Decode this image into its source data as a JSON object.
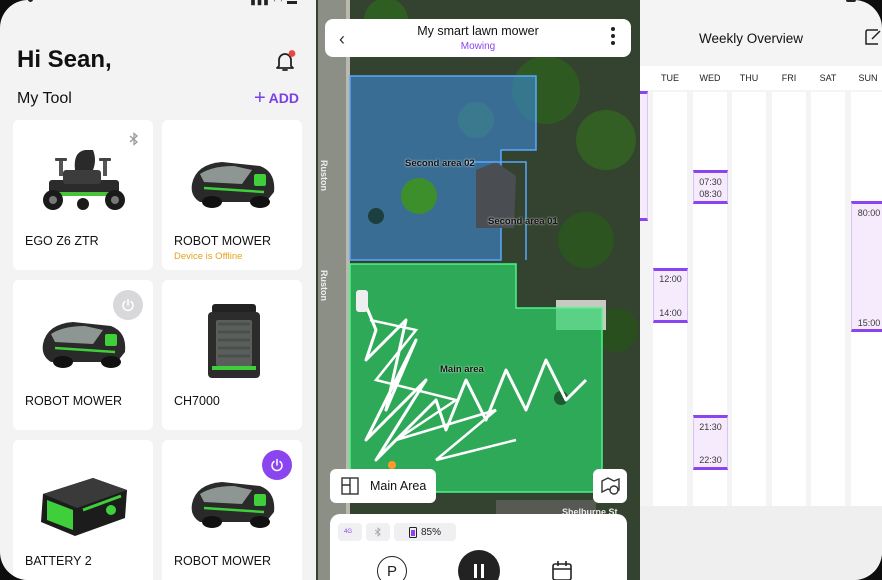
{
  "home": {
    "greeting": "Hi Sean,",
    "section_title": "My Tool",
    "add_label": "ADD",
    "tools": [
      {
        "name": "EGO Z6 ZTR",
        "status": "",
        "control": "bluetooth"
      },
      {
        "name": "ROBOT MOWER",
        "status": "Device is Offline",
        "control": ""
      },
      {
        "name": "ROBOT MOWER",
        "status": "",
        "control": "power-off"
      },
      {
        "name": "CH7000",
        "status": "",
        "control": ""
      },
      {
        "name": "BATTERY 2",
        "status": "",
        "control": ""
      },
      {
        "name": "ROBOT MOWER",
        "status": "",
        "control": "power-on"
      }
    ]
  },
  "map": {
    "title": "My smart lawn mower",
    "state": "Mowing",
    "zones": [
      "Second area 02",
      "Second area 01",
      "Main area"
    ],
    "streets": [
      "Ruston",
      "Ruston",
      "Shelburne St"
    ],
    "area_selector": "Main Area",
    "status_chips": {
      "signal": "4G",
      "battery": "85%"
    }
  },
  "weekly": {
    "title": "Weekly Overview",
    "days": [
      "TUE",
      "WED",
      "THU",
      "FRI",
      "SAT",
      "SUN"
    ],
    "slots": [
      {
        "day": "WED",
        "start": "07:30",
        "end": "08:30"
      },
      {
        "day": "TUE",
        "start": "12:00",
        "end": "14:00"
      },
      {
        "day": "WED",
        "start": "21:30",
        "end": "22:30"
      },
      {
        "day": "SUN",
        "start": "80:00",
        "end": "15:00"
      }
    ]
  },
  "colors": {
    "accent": "#8a45f0",
    "offline": "#e3a31b",
    "mowed_zone": "#2bd46a",
    "area_zone": "#3f8fe6"
  }
}
